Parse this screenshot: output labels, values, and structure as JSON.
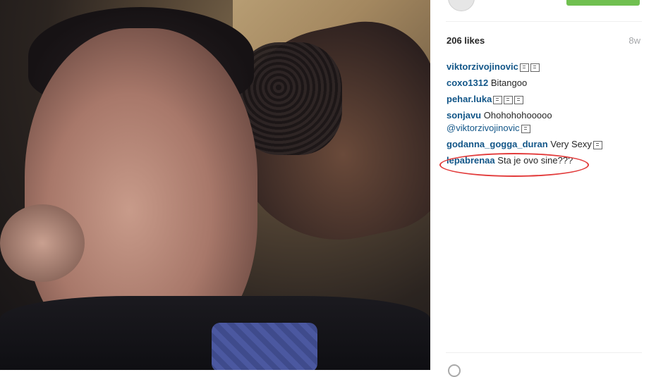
{
  "post": {
    "likes": "206 likes",
    "time_ago": "8w"
  },
  "comments": [
    {
      "user": "viktorzivojinovic",
      "text": "",
      "mention": "",
      "glyphs": 2
    },
    {
      "user": "coxo1312",
      "text": "Bitangoo",
      "mention": "",
      "glyphs": 0
    },
    {
      "user": "pehar.luka",
      "text": "",
      "mention": "",
      "glyphs": 3
    },
    {
      "user": "sonjavu",
      "text": "Ohohohohooooo",
      "mention": "@viktorzivojinovic",
      "glyphs": 1
    },
    {
      "user": "godanna_gogga_duran",
      "text": "Very Sexy",
      "mention": "",
      "glyphs": 1
    },
    {
      "user": "lepabrenaa",
      "text": "Sta je ovo sine???",
      "mention": "",
      "glyphs": 0
    }
  ],
  "colors": {
    "username": "#125688",
    "follow_button": "#70c050",
    "highlight": "#e23a3a"
  },
  "icons": {
    "emoji_placeholder": "unknown-glyph-icon",
    "avatar": "avatar",
    "like": "heart-icon"
  }
}
